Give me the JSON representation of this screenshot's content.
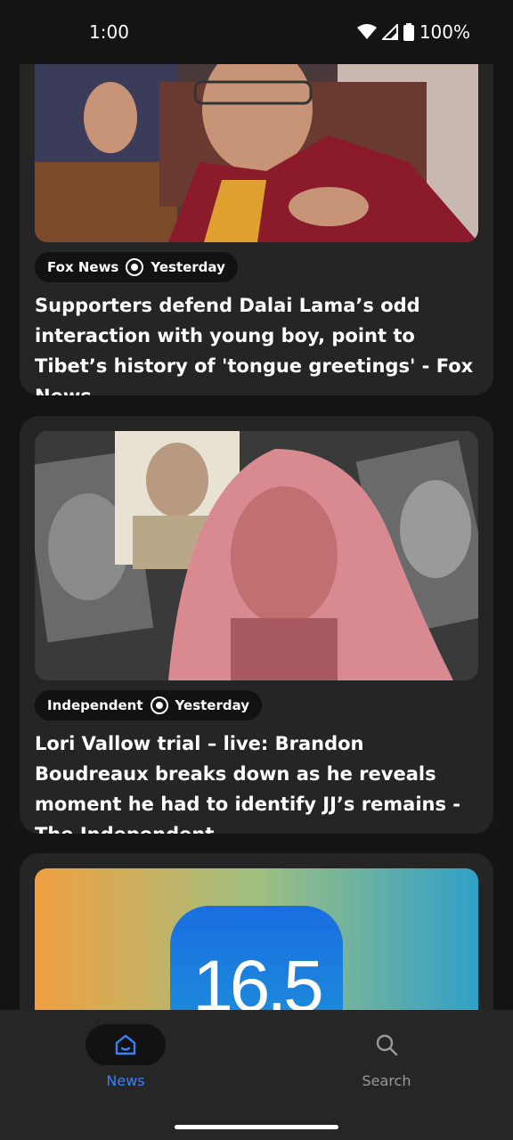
{
  "status_bar": {
    "time": "1:00",
    "battery": "100%",
    "icons": [
      "wifi-icon",
      "signal-icon",
      "battery-icon"
    ]
  },
  "articles": [
    {
      "source": "Fox News",
      "time": "Yesterday",
      "title": "Supporters defend Dalai Lama’s odd interaction with young boy, point to Tibet’s history of 'tongue greetings' - Fox News"
    },
    {
      "source": "Independent",
      "time": "Yesterday",
      "title": "Lori Vallow trial – live: Brandon Boudreaux breaks down as he reveals moment he had to identify JJ’s remains - The Independent"
    },
    {
      "image_text": "16.5"
    }
  ],
  "bottom_nav": {
    "items": [
      {
        "label": "News",
        "icon": "home-icon",
        "active": true
      },
      {
        "label": "Search",
        "icon": "search-icon",
        "active": false
      }
    ]
  },
  "colors": {
    "background": "#141414",
    "card": "#252525",
    "accent": "#3b82f6"
  }
}
